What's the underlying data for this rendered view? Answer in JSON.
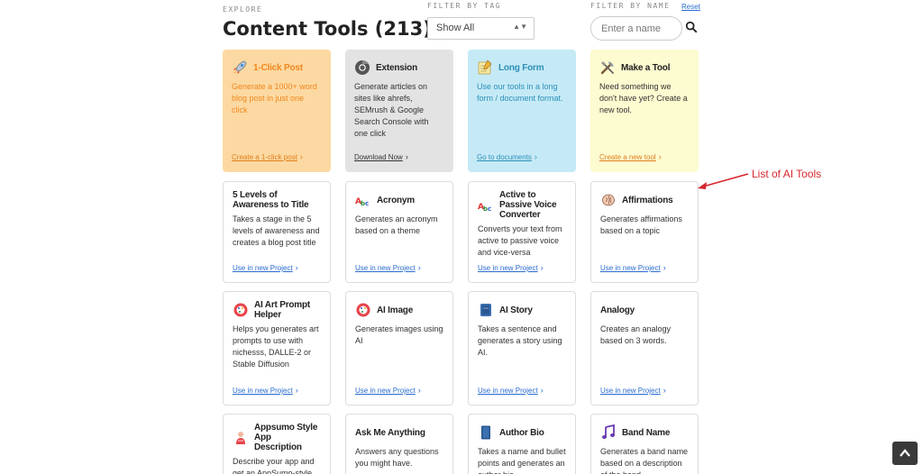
{
  "header": {
    "explore_label": "EXPLORE",
    "title": "Content Tools (213)"
  },
  "filters": {
    "tag_label": "FILTER BY TAG",
    "tag_selected": "Show All",
    "name_label": "FILTER BY NAME",
    "reset_label": "Reset",
    "name_placeholder": "Enter a name"
  },
  "featured": [
    {
      "title": "1-Click Post",
      "desc": "Generate a 1000+ word blog post in just one click",
      "link": "Create a 1-click post",
      "icon": "rocket-icon",
      "color": "#fcd9a2"
    },
    {
      "title": "Extension",
      "desc": "Generate articles on sites like ahrefs, SEMrush & Google Search Console with one click",
      "link": "Download Now",
      "icon": "chrome-icon",
      "color": "#e3e3e3"
    },
    {
      "title": "Long Form",
      "desc": "Use our tools in a long form / document format.",
      "link": "Go to documents",
      "icon": "notepad-icon",
      "color": "#c5eaf6"
    },
    {
      "title": "Make a Tool",
      "desc": "Need something we don't have yet? Create a new tool.",
      "link": "Create a new tool",
      "icon": "tools-icon",
      "color": "#fdfbd0"
    }
  ],
  "tools": [
    {
      "title": "5 Levels of Awareness to Title",
      "desc": "Takes a stage in the 5 levels of awareness and creates a blog post title",
      "link": "Use in new Project",
      "icon": ""
    },
    {
      "title": "Acronym",
      "desc": "Generates an acronym based on a theme",
      "link": "Use in new Project",
      "icon": "abc-icon"
    },
    {
      "title": "Active to Passive Voice Converter",
      "desc": "Converts your text from active to passive voice and vice-versa",
      "link": "Use in new Project",
      "icon": "abc-icon"
    },
    {
      "title": "Affirmations",
      "desc": "Generates affirmations based on a topic",
      "link": "Use in new Project",
      "icon": "brain-icon"
    },
    {
      "title": "AI Art Prompt Helper",
      "desc": "Helps you generates art prompts to use with nichesss, DALLE-2 or Stable Diffusion",
      "link": "Use in new Project",
      "icon": "palette-icon"
    },
    {
      "title": "AI Image",
      "desc": "Generates images using AI",
      "link": "Use in new Project",
      "icon": "palette-icon"
    },
    {
      "title": "AI Story",
      "desc": "Takes a sentence and generates a story using AI.",
      "link": "Use in new Project",
      "icon": "book-icon"
    },
    {
      "title": "Analogy",
      "desc": "Creates an analogy based on 3 words.",
      "link": "Use in new Project",
      "icon": ""
    },
    {
      "title": "Appsumo Style App Description",
      "desc": "Describe your app and get an AppSumo-style",
      "link": "",
      "icon": "person-icon"
    },
    {
      "title": "Ask Me Anything",
      "desc": "Answers any questions you might have.",
      "link": "",
      "icon": ""
    },
    {
      "title": "Author Bio",
      "desc": "Takes a name and bullet points and generates an author bio.",
      "link": "",
      "icon": "blue-book-icon"
    },
    {
      "title": "Band Name",
      "desc": "Generates a band name based on a description of the band",
      "link": "",
      "icon": "music-note-icon"
    }
  ],
  "annotation": {
    "text": "List of AI Tools",
    "color": "#d8262d"
  },
  "back_to_top": {
    "icon": "chevron-up-icon"
  }
}
